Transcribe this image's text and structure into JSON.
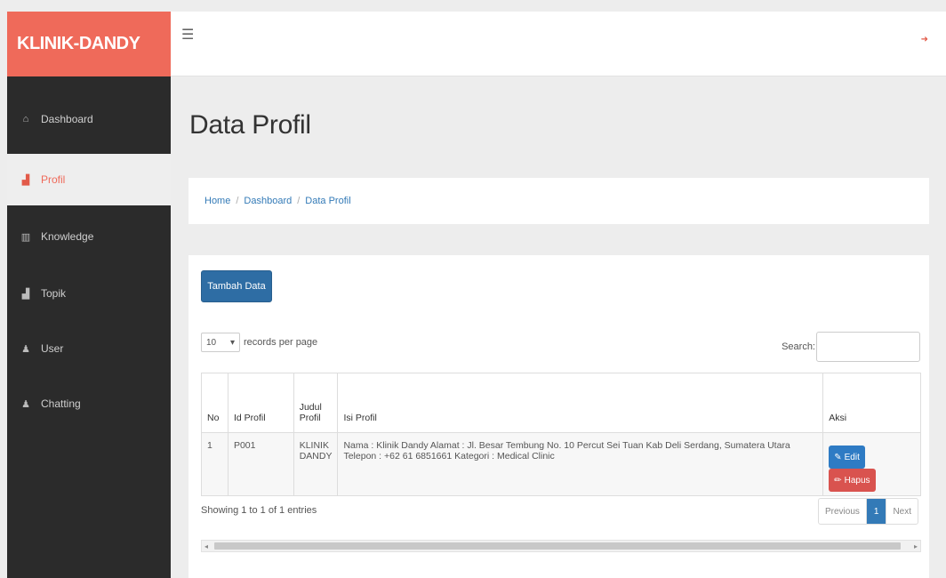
{
  "brand": "KLINIK-DANDY",
  "colors": {
    "brand_bg": "#ef6a5a",
    "sidebar_bg": "#2b2b2b",
    "primary": "#337ab7",
    "danger": "#d9534f"
  },
  "topbar": {
    "menu_icon": "hamburger-icon",
    "logout_icon": "logout-icon"
  },
  "sidebar": {
    "items": [
      {
        "label": "Dashboard",
        "icon": "home-icon",
        "glyph": "⌂",
        "active": false
      },
      {
        "label": "Profil",
        "icon": "bar-chart-icon",
        "glyph": "▟",
        "active": true
      },
      {
        "label": "Knowledge",
        "icon": "table-icon",
        "glyph": "▥",
        "active": false
      },
      {
        "label": "Topik",
        "icon": "bar-chart-icon",
        "glyph": "▟",
        "active": false
      },
      {
        "label": "User",
        "icon": "user-icon",
        "glyph": "♟",
        "active": false
      },
      {
        "label": "Chatting",
        "icon": "user-icon",
        "glyph": "♟",
        "active": false
      }
    ]
  },
  "page": {
    "title": "Data Profil"
  },
  "breadcrumb": {
    "items": [
      "Home",
      "Dashboard",
      "Data Profil"
    ]
  },
  "toolbar": {
    "add_button": "Tambah Data"
  },
  "table_controls": {
    "length_value": "10",
    "length_suffix": "records per page",
    "search_label": "Search:",
    "search_value": ""
  },
  "table": {
    "headers": [
      "No",
      "Id Profil",
      "Judul Profil",
      "Isi Profil",
      "Aksi"
    ],
    "rows": [
      {
        "no": "1",
        "id": "P001",
        "judul": "KLINIK DANDY",
        "isi": "Nama : Klinik Dandy Alamat : Jl. Besar Tembung No. 10 Percut Sei Tuan Kab Deli Serdang, Sumatera Utara Telepon : +62 61 6851661 Kategori : Medical Clinic",
        "edit_label": "Edit",
        "hapus_label": "Hapus"
      }
    ]
  },
  "footer": {
    "info": "Showing 1 to 1 of 1 entries",
    "prev": "Previous",
    "page": "1",
    "next": "Next"
  }
}
